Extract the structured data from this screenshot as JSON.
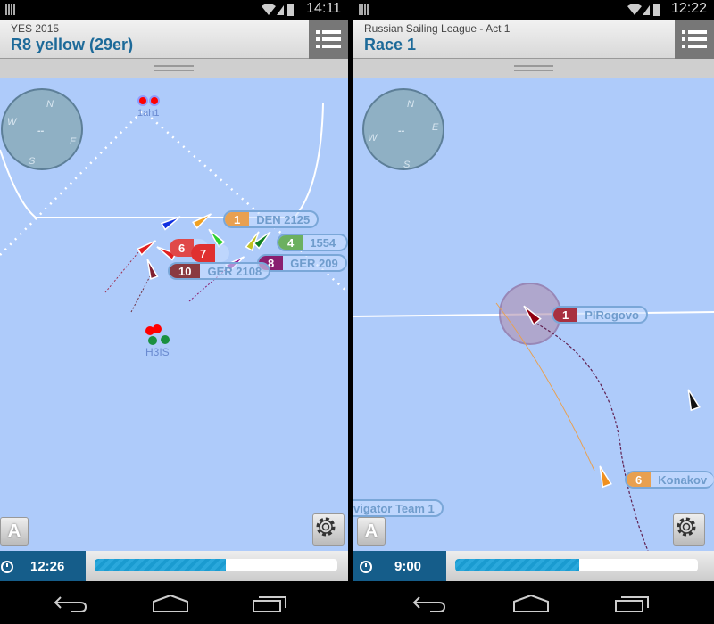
{
  "left": {
    "status_time": "14:11",
    "header": {
      "subtitle": "YES 2015",
      "title": "R8 yellow (29er)"
    },
    "compass": {
      "n": "N",
      "e": "E",
      "s": "S",
      "w": "W",
      "wind": "--"
    },
    "marks": {
      "top": "1ah1",
      "gate": "H3IS"
    },
    "competitors": [
      {
        "num": "1",
        "name": "DEN 2125",
        "color": "#e8a050"
      },
      {
        "num": "4",
        "name": "1554",
        "color": "#6cb060"
      },
      {
        "num": "6",
        "name": "",
        "color": "#e04848"
      },
      {
        "num": "7",
        "name": "",
        "color": "#e03030"
      },
      {
        "num": "8",
        "name": "GER 209",
        "color": "#8a2070"
      },
      {
        "num": "10",
        "name": "GER 2108",
        "color": "#8a3a40"
      }
    ],
    "a_button": "A",
    "clock": "12:26",
    "progress_percent": 54
  },
  "right": {
    "status_time": "12:22",
    "header": {
      "subtitle": "Russian Sailing League - Act 1",
      "title": "Race 1"
    },
    "compass": {
      "n": "N",
      "e": "E",
      "s": "S",
      "w": "W",
      "wind": "--"
    },
    "competitors": [
      {
        "num": "1",
        "name": "PIRogovo",
        "color": "#a83040"
      },
      {
        "num": "6",
        "name": "Konakov",
        "color": "#e8a050"
      },
      {
        "num": "",
        "name": "vigator Team 1",
        "color": ""
      }
    ],
    "a_button": "A",
    "clock": "9:00",
    "progress_percent": 51
  },
  "colors": {
    "map": "#aecbfa",
    "header_title": "#1d6a99",
    "clock_bg": "#155d8a",
    "progress": "#1a9bd0"
  }
}
